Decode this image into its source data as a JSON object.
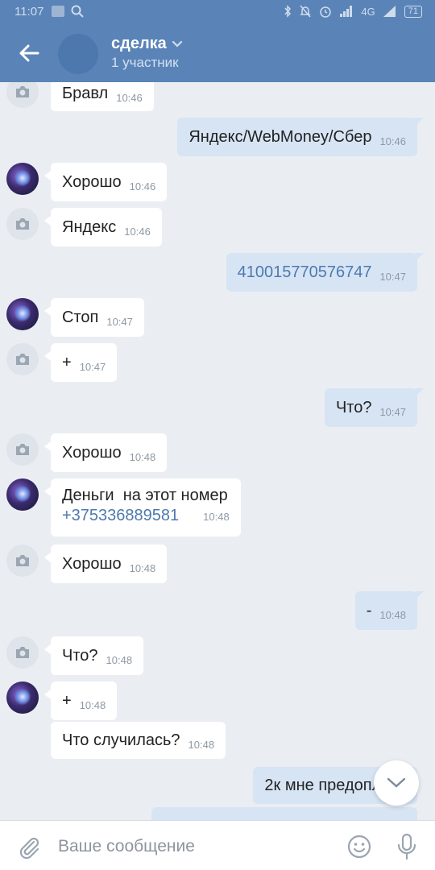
{
  "status_bar": {
    "time": "11:07",
    "network": "4G",
    "battery": "71"
  },
  "header": {
    "title": "сделка",
    "subtitle": "1 участник"
  },
  "messages": [
    {
      "dir": "in",
      "avatar": "camera",
      "text": "Бравл",
      "time": "10:46"
    },
    {
      "dir": "out",
      "text": "Яндекс/WebMoney/Сбер",
      "time": "10:46"
    },
    {
      "dir": "in",
      "avatar": "photo",
      "text": "Хорошо",
      "time": "10:46"
    },
    {
      "dir": "in",
      "avatar": "camera",
      "text": "Яндекс",
      "time": "10:46"
    },
    {
      "dir": "out",
      "text": "410015770576747",
      "time": "10:47"
    },
    {
      "dir": "in",
      "avatar": "photo",
      "text": "Стоп",
      "time": "10:47"
    },
    {
      "dir": "in",
      "avatar": "camera",
      "text": "+",
      "time": "10:47"
    },
    {
      "dir": "out",
      "text": "Что?",
      "time": "10:47"
    },
    {
      "dir": "in",
      "avatar": "camera",
      "text": "Хорошо",
      "time": "10:48"
    },
    {
      "dir": "in",
      "avatar": "photo",
      "text": "Деньги  на этот номер",
      "link": "+375336889581",
      "time": "10:48"
    },
    {
      "dir": "in",
      "avatar": "camera",
      "text": "Хорошо",
      "time": "10:48"
    },
    {
      "dir": "out",
      "text": "-",
      "time": "10:48"
    },
    {
      "dir": "in",
      "avatar": "camera",
      "text": "Что?",
      "time": "10:48"
    },
    {
      "dir": "in",
      "avatar": "photo",
      "text": "+",
      "time": "10:48"
    },
    {
      "dir": "in",
      "avatar": "none",
      "text": "Что случилась?",
      "time": "10:48"
    },
    {
      "dir": "out",
      "text": "2к мне предоплата",
      "time": ""
    }
  ],
  "input": {
    "placeholder": "Ваше сообщение"
  },
  "icons": {
    "back": "arrow-left-icon",
    "dropdown": "chevron-down-icon",
    "camera": "camera-icon",
    "attach": "paperclip-icon",
    "emoji": "smile-icon",
    "mic": "microphone-icon",
    "scroll": "chevron-down-icon"
  },
  "colors": {
    "header": "#5a84b8",
    "background": "#eaeef3",
    "bubble_in": "#ffffff",
    "bubble_out": "#d7e4f4",
    "link": "#4d7aaf"
  }
}
